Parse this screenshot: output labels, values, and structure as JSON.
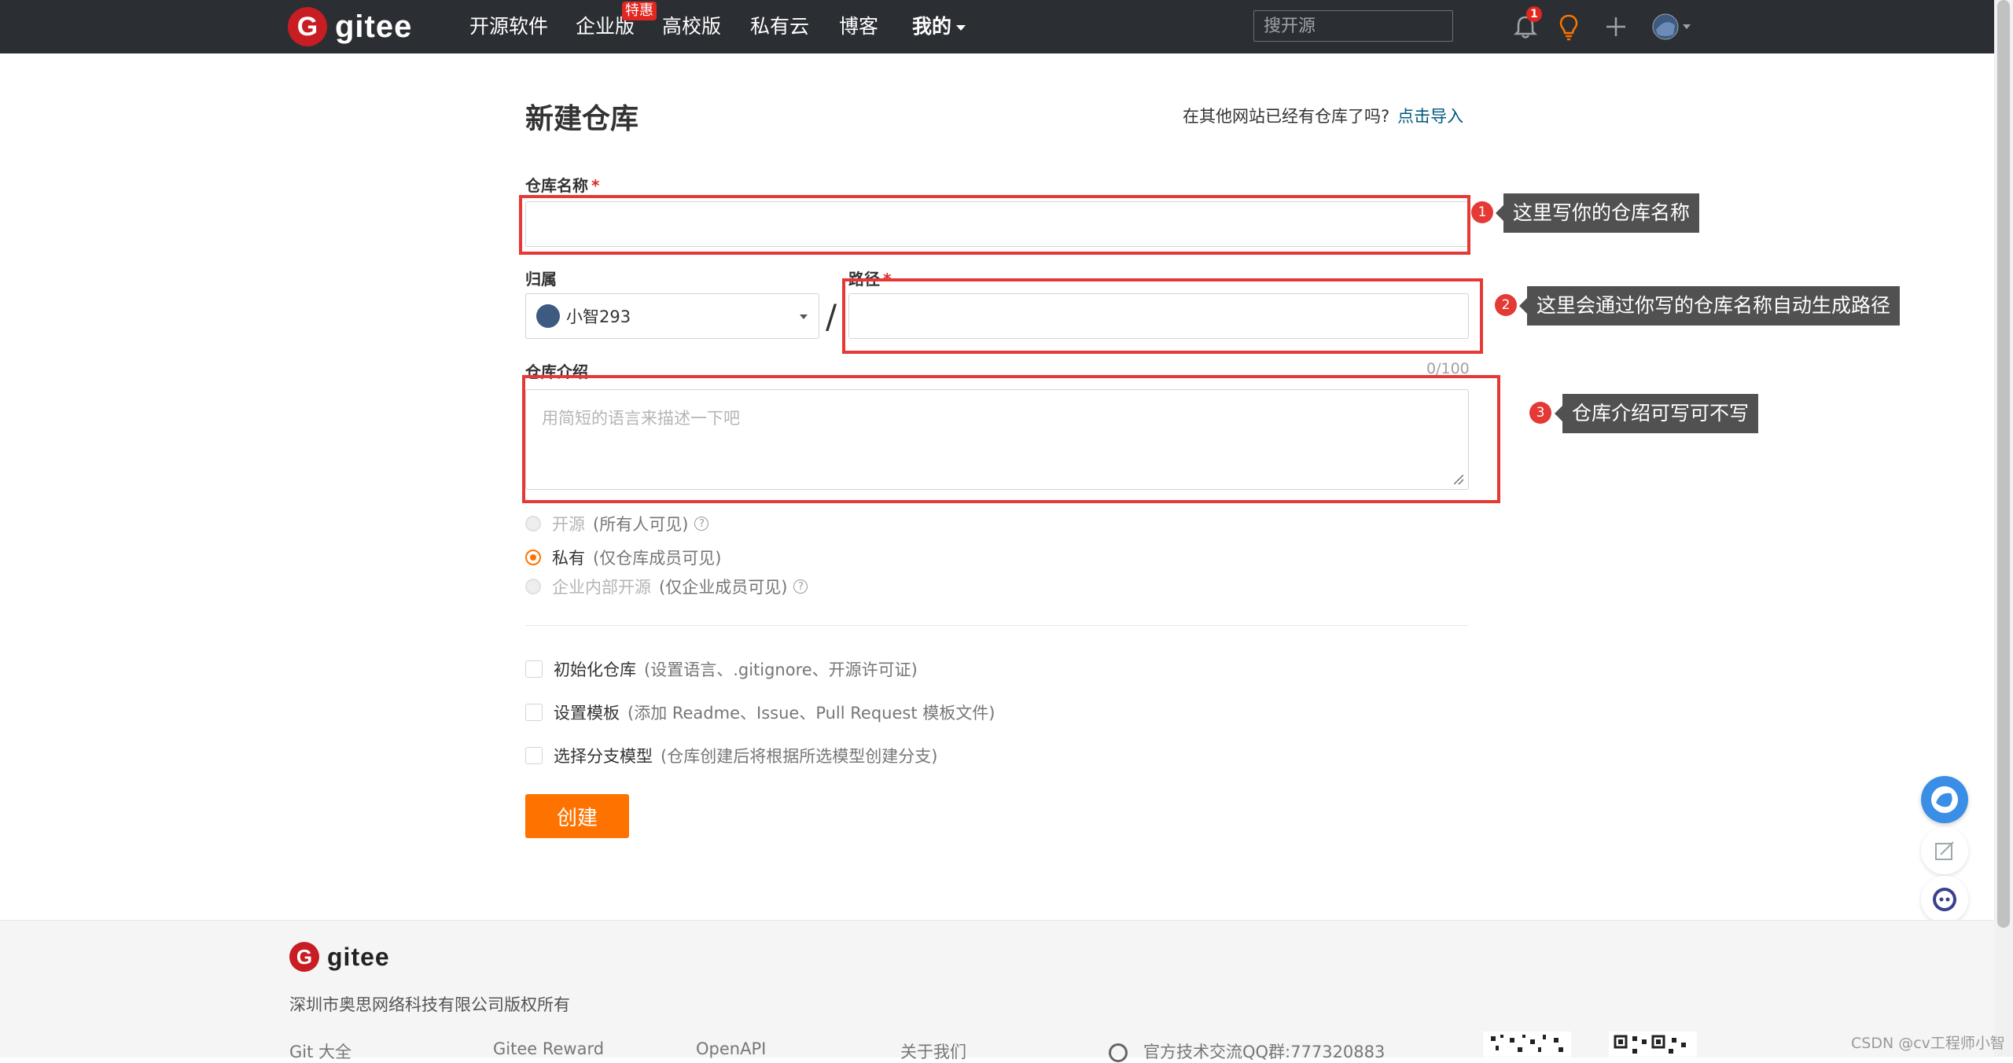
{
  "navbar": {
    "brand": "gitee",
    "items": [
      {
        "label": "开源软件"
      },
      {
        "label": "企业版"
      },
      {
        "label": "高校版"
      },
      {
        "label": "私有云"
      },
      {
        "label": "博客"
      },
      {
        "label": "我的"
      }
    ],
    "enterprise_badge": "特惠",
    "search_placeholder": "搜开源",
    "notification_count": "1"
  },
  "form": {
    "title": "新建仓库",
    "import_prompt": "在其他网站已经有仓库了吗?",
    "import_link": "点击导入",
    "repo_name_label": "仓库名称",
    "required_mark": "*",
    "owner_label": "归属",
    "owner_value": "小智293",
    "path_label": "路径",
    "path_separator": "/",
    "description_label": "仓库介绍",
    "description_counter": "0/100",
    "description_placeholder": "用简短的语言来描述一下吧",
    "visibility": [
      {
        "label": "开源",
        "hint": "(所有人可见)",
        "checked": false,
        "disabled": true,
        "help": true
      },
      {
        "label": "私有",
        "hint": "(仅仓库成员可见)",
        "checked": true,
        "disabled": false,
        "help": false
      },
      {
        "label": "企业内部开源",
        "hint": "(仅企业成员可见)",
        "checked": false,
        "disabled": true,
        "help": true
      }
    ],
    "options": [
      {
        "label": "初始化仓库",
        "hint": "(设置语言、.gitignore、开源许可证)",
        "checked": false
      },
      {
        "label": "设置模板",
        "hint": "(添加 Readme、Issue、Pull Request 模板文件)",
        "checked": false
      },
      {
        "label": "选择分支模型",
        "hint": "(仓库创建后将根据所选模型创建分支)",
        "checked": false
      }
    ],
    "submit_label": "创建"
  },
  "annotations": [
    {
      "number": "1",
      "text": "这里写你的仓库名称"
    },
    {
      "number": "2",
      "text": "这里会通过你写的仓库名称自动生成路径"
    },
    {
      "number": "3",
      "text": "仓库介绍可写可不写"
    }
  ],
  "footer": {
    "brand": "gitee",
    "copyright": "深圳市奥思网络科技有限公司版权所有",
    "links": [
      "Git 大全",
      "Gitee Reward",
      "OpenAPI",
      "关于我们"
    ],
    "qq_group": "官方技术交流QQ群:777320883"
  },
  "watermark": "CSDN @cv工程师小智",
  "colors": {
    "navbar_bg": "#2b2f33",
    "brand_red": "#c71d23",
    "accent_orange": "#fe7300",
    "annotation_red": "#e53935",
    "link_blue": "#005980"
  }
}
